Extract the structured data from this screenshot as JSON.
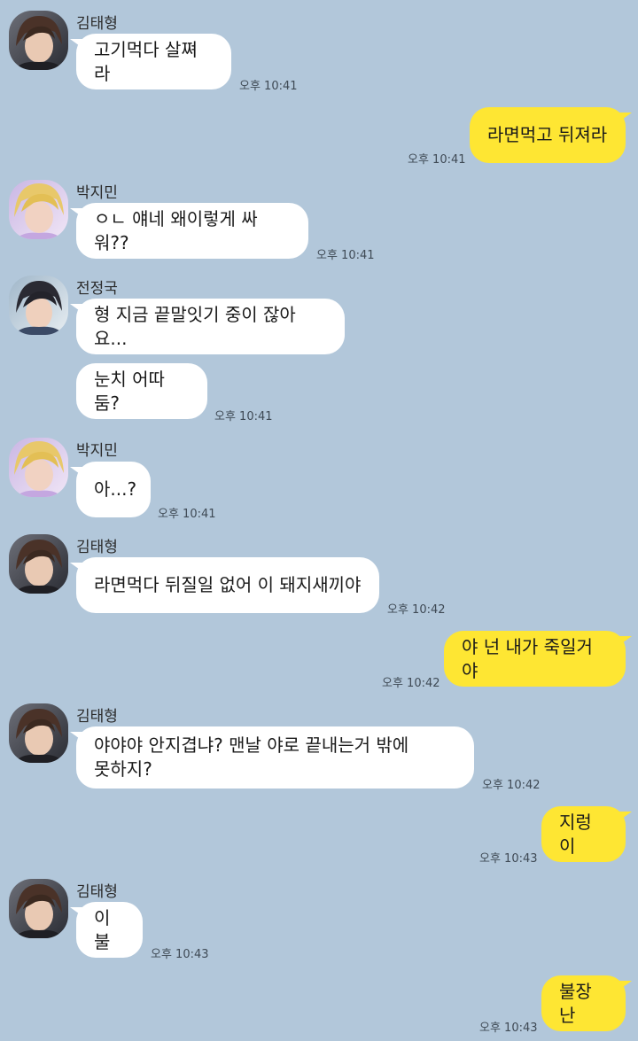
{
  "messages": [
    {
      "sender": "김태형",
      "text": "고기먹다 살쪄라",
      "time": "오후 10:41"
    },
    {
      "text": "라면먹고 뒤져라",
      "time": "오후 10:41"
    },
    {
      "sender": "박지민",
      "text": "ㅇㄴ 얘네 왜이렇게 싸워??",
      "time": "오후 10:41"
    },
    {
      "sender": "전정국",
      "text": "형 지금 끝말잇기 중이 잖아요..."
    },
    {
      "text": "눈치 어따둠?",
      "time": "오후 10:41"
    },
    {
      "sender": "박지민",
      "text": "아...?",
      "time": "오후 10:41"
    },
    {
      "sender": "김태형",
      "text": "라면먹다 뒤질일 없어 이 돼지새끼야",
      "time": "오후 10:42"
    },
    {
      "text": "야 넌 내가 죽일거야",
      "time": "오후 10:42"
    },
    {
      "sender": "김태형",
      "text": "야야야 안지겹냐? 맨날 야로 끝내는거 밖에\n못하지?",
      "time": "오후 10:42"
    },
    {
      "text": "지렁이",
      "time": "오후 10:43"
    },
    {
      "sender": "김태형",
      "text": "이불",
      "time": "오후 10:43"
    },
    {
      "text": "불장난",
      "time": "오후 10:43"
    }
  ]
}
